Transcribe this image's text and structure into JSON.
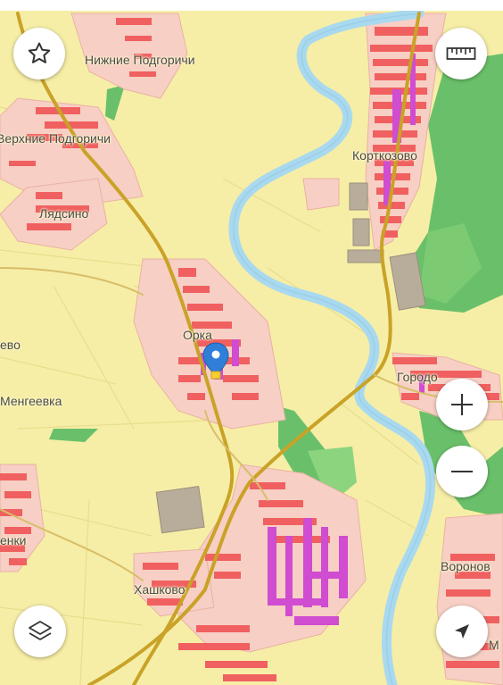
{
  "map": {
    "labels": [
      {
        "id": "nizhnie-podgorichi",
        "text": "Нижние Подгоричи"
      },
      {
        "id": "verkhnie-podgorichi",
        "text": "Верхние Подгоричи"
      },
      {
        "id": "lyadsino",
        "text": "Лядсино"
      },
      {
        "id": "korkmazovo",
        "text": "Корткозово"
      },
      {
        "id": "orka",
        "text": "Орка"
      },
      {
        "id": "evo",
        "text": "ево"
      },
      {
        "id": "mengeevka",
        "text": "Менгеевка"
      },
      {
        "id": "gorodok",
        "text": "Городо"
      },
      {
        "id": "lenki",
        "text": "енки"
      },
      {
        "id": "khashkovo",
        "text": "Хашково"
      },
      {
        "id": "voronovo",
        "text": "Воронов"
      },
      {
        "id": "m-edge",
        "text": "М"
      }
    ]
  },
  "controls": {
    "favorite": {
      "icon": "star-icon"
    },
    "ruler": {
      "icon": "ruler-icon"
    },
    "zoom_in": {
      "icon": "plus-icon"
    },
    "zoom_out": {
      "icon": "minus-icon"
    },
    "layers": {
      "icon": "layers-icon"
    },
    "locate": {
      "icon": "navigation-arrow-icon"
    }
  },
  "colors": {
    "land": "#f6eea6",
    "forest": "#6ac06a",
    "river": "#a9d9ef",
    "road": "#c9a227",
    "building": "#f06060",
    "building_alt": "#d04cd0",
    "settlement": "#f7cfc4",
    "marker": "#2f7fd9"
  }
}
